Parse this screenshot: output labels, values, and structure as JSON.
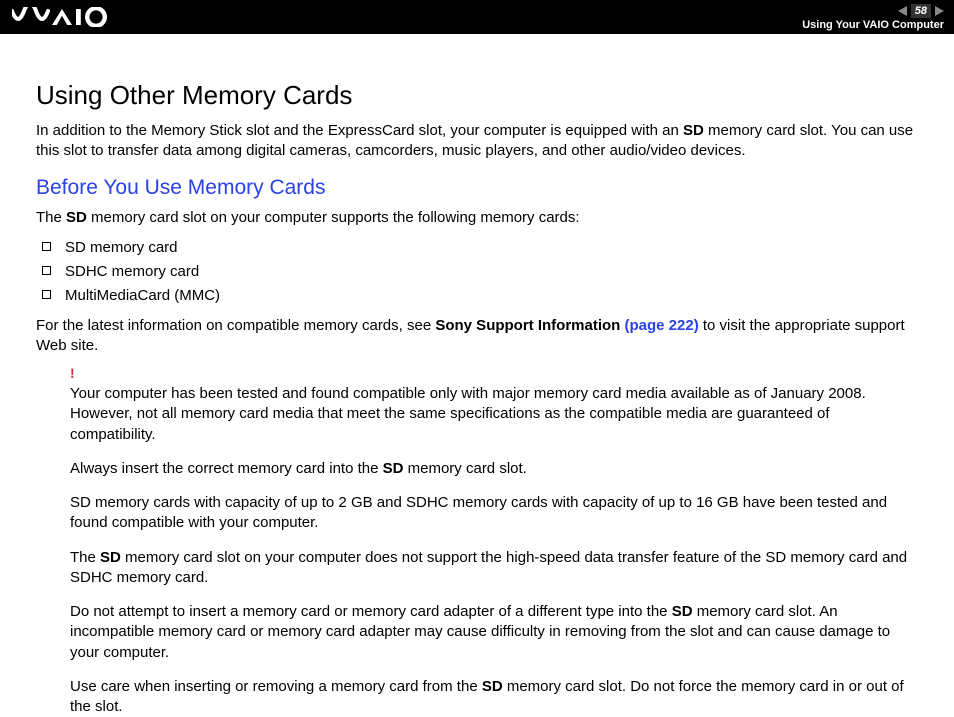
{
  "header": {
    "page_number": "58",
    "section": "Using Your VAIO Computer"
  },
  "title": "Using Other Memory Cards",
  "intro_pre": "In addition to the Memory Stick slot and the ExpressCard slot, your computer is equipped with an ",
  "intro_bold": "SD",
  "intro_post": " memory card slot. You can use this slot to transfer data among digital cameras, camcorders, music players, and other audio/video devices.",
  "subhead": "Before You Use Memory Cards",
  "support_pre": "The ",
  "support_bold": "SD",
  "support_post": " memory card slot on your computer supports the following memory cards:",
  "list": [
    "SD memory card",
    "SDHC memory card",
    "MultiMediaCard (MMC)"
  ],
  "latest_pre": "For the latest information on compatible memory cards, see ",
  "latest_link_label": "Sony Support Information ",
  "latest_link_page": "(page 222)",
  "latest_post": " to visit the appropriate support Web site.",
  "bang": "!",
  "notes": {
    "n1": "Your computer has been tested and found compatible only with major memory card media available as of January 2008. However, not all memory card media that meet the same specifications as the compatible media are guaranteed of compatibility.",
    "n2_pre": "Always insert the correct memory card into the ",
    "n2_bold": "SD",
    "n2_post": " memory card slot.",
    "n3": "SD memory cards with capacity of up to 2 GB and SDHC memory cards with capacity of up to 16 GB have been tested and found compatible with your computer.",
    "n4_pre": "The ",
    "n4_bold": "SD",
    "n4_post": " memory card slot on your computer does not support the high-speed data transfer feature of the SD memory card and SDHC memory card.",
    "n5_pre": "Do not attempt to insert a memory card or memory card adapter of a different type into the ",
    "n5_bold": "SD",
    "n5_post": " memory card slot. An incompatible memory card or memory card adapter may cause difficulty in removing from the slot and can cause damage to your computer.",
    "n6_pre": "Use care when inserting or removing a memory card from the ",
    "n6_bold": "SD",
    "n6_post": " memory card slot. Do not force the memory card in or out of the slot."
  }
}
